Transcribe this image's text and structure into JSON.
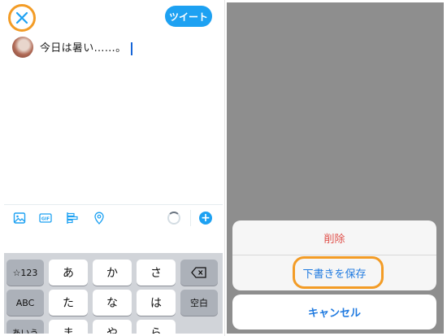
{
  "compose": {
    "tweet_button": "ツイート",
    "text": "今日は暑い……。"
  },
  "keyboard": {
    "row1": [
      "☆123",
      "あ",
      "か",
      "さ"
    ],
    "row2": [
      "ABC",
      "た",
      "な",
      "は",
      "空白"
    ],
    "row3": [
      "あいう",
      "ま",
      "や",
      "ら"
    ]
  },
  "action_sheet": {
    "delete": "削除",
    "save_draft": "下書きを保存",
    "cancel": "キャンセル"
  },
  "colors": {
    "accent": "#1da1f2",
    "highlight": "#f39c26",
    "destructive": "#e0514b",
    "action_blue": "#1f7ae0"
  },
  "icons": [
    "close-icon",
    "image-icon",
    "gif-icon",
    "poll-icon",
    "location-icon",
    "backspace-icon",
    "plus-icon"
  ]
}
